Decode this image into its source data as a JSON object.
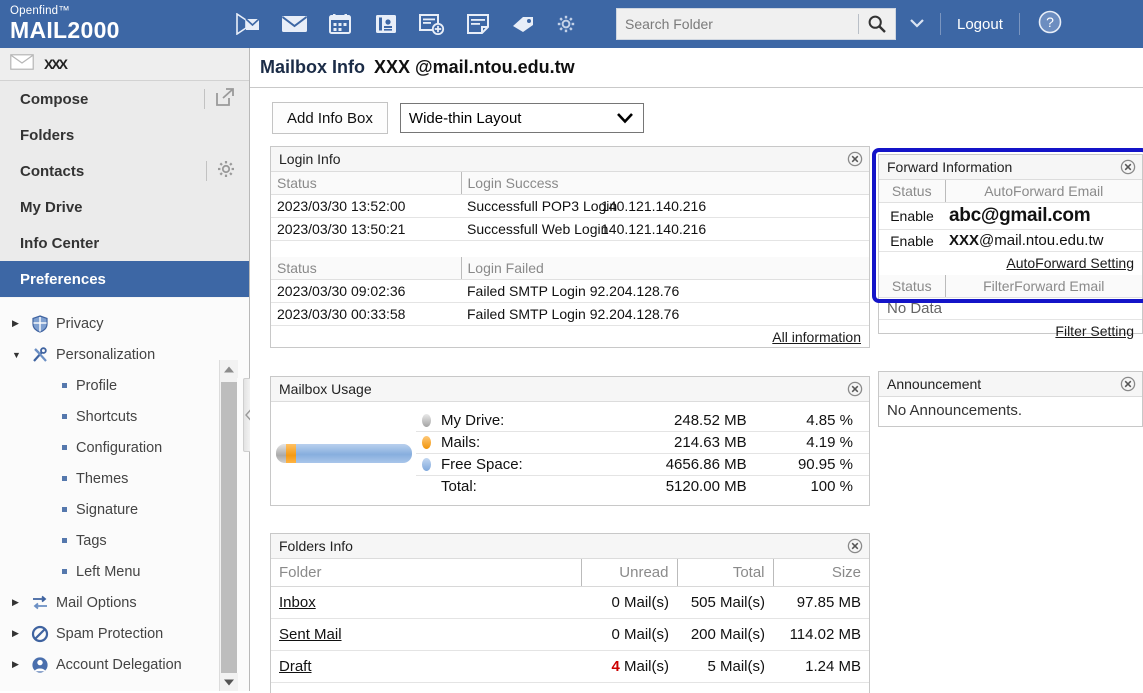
{
  "header": {
    "brand_sup": "Openfind™",
    "brand_name": "MAIL2000",
    "icons": [
      {
        "name": "send-mail-icon",
        "label": "Send Mail"
      },
      {
        "name": "mail-icon",
        "label": "Mail"
      },
      {
        "name": "calendar-icon",
        "label": "Calendar"
      },
      {
        "name": "contacts-icon",
        "label": "Contacts"
      },
      {
        "name": "add-note-icon",
        "label": "New Note"
      },
      {
        "name": "notes-icon",
        "label": "Notes"
      },
      {
        "name": "tags-icon",
        "label": "Tags"
      },
      {
        "name": "gear-icon",
        "label": "Settings"
      }
    ],
    "search": {
      "placeholder": "Search Folder",
      "value": ""
    },
    "logout_label": "Logout",
    "help_label": "?"
  },
  "sidebar": {
    "user_name": "XXX",
    "nav": [
      {
        "label": "Compose",
        "active": false,
        "right_icon": "open-external-icon"
      },
      {
        "label": "Folders",
        "active": false,
        "right_icon": ""
      },
      {
        "label": "Contacts",
        "active": false,
        "right_icon": "gear-icon"
      },
      {
        "label": "My Drive",
        "active": false,
        "right_icon": ""
      },
      {
        "label": "Info Center",
        "active": false,
        "right_icon": ""
      },
      {
        "label": "Preferences",
        "active": true,
        "right_icon": ""
      }
    ],
    "tree": [
      {
        "type": "node",
        "label": "Privacy",
        "expanded": false,
        "icon": "shield-icon",
        "arrow": "▶"
      },
      {
        "type": "node",
        "label": "Personalization",
        "expanded": true,
        "icon": "tools-icon",
        "arrow": "▼"
      },
      {
        "type": "leaf",
        "label": "Profile"
      },
      {
        "type": "leaf",
        "label": "Shortcuts"
      },
      {
        "type": "leaf",
        "label": "Configuration"
      },
      {
        "type": "leaf",
        "label": "Themes"
      },
      {
        "type": "leaf",
        "label": "Signature"
      },
      {
        "type": "leaf",
        "label": "Tags"
      },
      {
        "type": "leaf",
        "label": "Left Menu"
      },
      {
        "type": "node",
        "label": "Mail Options",
        "expanded": false,
        "icon": "mail-options-icon",
        "arrow": "▶"
      },
      {
        "type": "node",
        "label": "Spam Protection",
        "expanded": false,
        "icon": "block-icon",
        "arrow": "▶"
      },
      {
        "type": "node",
        "label": "Account Delegation",
        "expanded": false,
        "icon": "user-icon",
        "arrow": "▶"
      }
    ]
  },
  "main": {
    "page_title": "Mailbox Info",
    "account_mask": "XXX",
    "account_domain": "@mail.ntou.edu.tw",
    "add_info_box_label": "Add Info Box",
    "layout_value": "Wide-thin Layout"
  },
  "login_info": {
    "title": "Login Info",
    "success_headers": [
      "Status",
      "Login Success"
    ],
    "success_rows": [
      {
        "time": "2023/03/30 13:52:00",
        "event": "Successfull POP3 Login",
        "ip": "140.121.140.216"
      },
      {
        "time": "2023/03/30 13:50:21",
        "event": "Successfull Web Login",
        "ip": "140.121.140.216"
      }
    ],
    "failed_headers": [
      "Status",
      "Login Failed"
    ],
    "failed_rows": [
      {
        "time": "2023/03/30 09:02:36",
        "event": "Failed SMTP Login",
        "ip": "92.204.128.76"
      },
      {
        "time": "2023/03/30 00:33:58",
        "event": "Failed SMTP Login",
        "ip": "92.204.128.76"
      }
    ],
    "footer_link": "All information"
  },
  "mailbox_usage": {
    "title": "Mailbox Usage",
    "rows": [
      {
        "label": "My Drive:",
        "size": "248.52 MB",
        "percent": "4.85 %",
        "dot": "drive"
      },
      {
        "label": "Mails:",
        "size": "214.63 MB",
        "percent": "4.19 %",
        "dot": "mails"
      },
      {
        "label": "Free Space:",
        "size": "4656.86 MB",
        "percent": "90.95 %",
        "dot": "free"
      },
      {
        "label": "Total:",
        "size": "5120.00 MB",
        "percent": "100 %",
        "dot": "none"
      }
    ]
  },
  "folders_info": {
    "title": "Folders Info",
    "headers": [
      "Folder",
      "Unread",
      "Total",
      "Size"
    ],
    "rows": [
      {
        "folder": "Inbox",
        "unread": "0 Mail(s)",
        "total": "505 Mail(s)",
        "size": "97.85 MB",
        "unread_hot": false
      },
      {
        "folder": "Sent Mail",
        "unread": "0 Mail(s)",
        "total": "200 Mail(s)",
        "size": "114.02 MB",
        "unread_hot": false
      },
      {
        "folder": "Draft",
        "unread": "4",
        "unread_unit": "Mail(s)",
        "total": "5 Mail(s)",
        "size": "1.24 MB",
        "unread_hot": true
      }
    ]
  },
  "forward_info": {
    "title": "Forward Information",
    "auto_headers": [
      "Status",
      "AutoForward Email"
    ],
    "auto_rows": [
      {
        "status": "Enable",
        "email": "abc@gmail.com",
        "big": true
      },
      {
        "status": "Enable",
        "email_mask": "XXX",
        "email_domain": "@mail.ntou.edu.tw",
        "big": false
      }
    ],
    "auto_setting_link": "AutoForward Setting",
    "filter_headers": [
      "Status",
      "FilterForward Email"
    ],
    "filter_no_data": "No Data",
    "filter_setting_link": "Filter Setting",
    "highlight_color": "#1414c8"
  },
  "announcement": {
    "title": "Announcement",
    "body": "No Announcements."
  }
}
